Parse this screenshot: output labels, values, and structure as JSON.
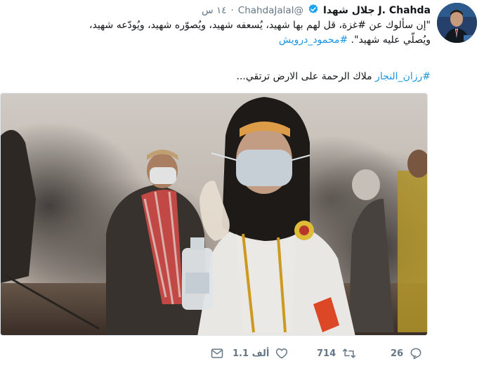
{
  "tweet": {
    "display_name": "J. Chahda جلال شهدا",
    "handle": "@ChahdaJalal",
    "separator": "·",
    "time": "١٤ س",
    "text_line1": "\"إن سألوك عن #غزة، قل لهم بها شهيد، يُسعفه شهيد، ويُصوّره شهيد، ويُودّعه شهيد،",
    "text_line2_prefix": "ويُصلّي عليه شهيد\". ",
    "text_line2_hashtag": "#محمود_درويش",
    "caption_hashtag": "#رزان_النجار",
    "caption_text": " ملاك الرحمة على الارض ترتقي..."
  },
  "actions": {
    "reply_count": "26",
    "retweet_count": "714",
    "like_count": "1.1 ألف"
  },
  "colors": {
    "link": "#1b95e0",
    "muted": "#657786",
    "verified": "#1da1f2"
  },
  "icons": [
    "verified-badge-icon",
    "reply-icon",
    "retweet-icon",
    "like-icon",
    "direct-message-icon"
  ]
}
